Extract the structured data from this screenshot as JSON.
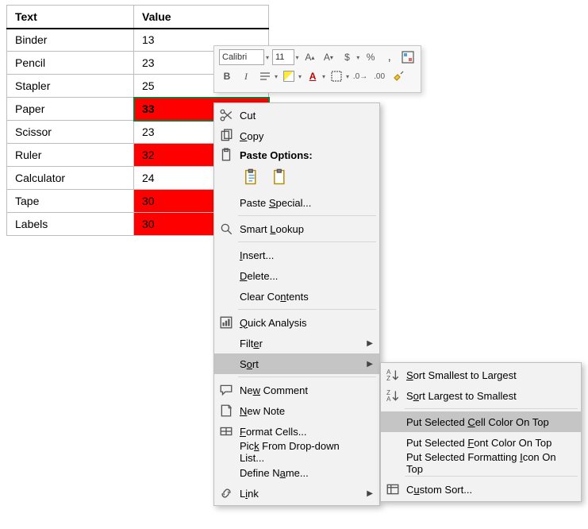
{
  "table": {
    "headers": [
      "Text",
      "Value"
    ],
    "rows": [
      {
        "text": "Binder",
        "value": "13",
        "red": false
      },
      {
        "text": "Pencil",
        "value": "23",
        "red": false
      },
      {
        "text": "Stapler",
        "value": "25",
        "red": false
      },
      {
        "text": "Paper",
        "value": "33",
        "red": true,
        "selected": true
      },
      {
        "text": "Scissor",
        "value": "23",
        "red": false
      },
      {
        "text": "Ruler",
        "value": "32",
        "red": true
      },
      {
        "text": "Calculator",
        "value": "24",
        "red": false
      },
      {
        "text": "Tape",
        "value": "30",
        "red": true
      },
      {
        "text": "Labels",
        "value": "30",
        "red": true
      }
    ]
  },
  "mini_toolbar": {
    "font_name": "Calibri",
    "font_size": "11"
  },
  "context_menu": {
    "cut": "Cut",
    "copy": "Copy",
    "paste_options": "Paste Options:",
    "paste_special": "Paste Special...",
    "smart_lookup": "Smart Lookup",
    "insert": "Insert...",
    "delete": "Delete...",
    "clear": "Clear Contents",
    "quick_analysis": "Quick Analysis",
    "filter": "Filter",
    "sort": "Sort",
    "new_comment": "New Comment",
    "new_note": "New Note",
    "format_cells": "Format Cells...",
    "pick_list": "Pick From Drop-down List...",
    "define_name": "Define Name...",
    "link": "Link"
  },
  "sort_submenu": {
    "smallest": "Sort Smallest to Largest",
    "largest": "Sort Largest to Smallest",
    "cell_color": "Put Selected Cell Color On Top",
    "font_color": "Put Selected Font Color On Top",
    "fmt_icon": "Put Selected Formatting Icon On Top",
    "custom": "Custom Sort..."
  }
}
